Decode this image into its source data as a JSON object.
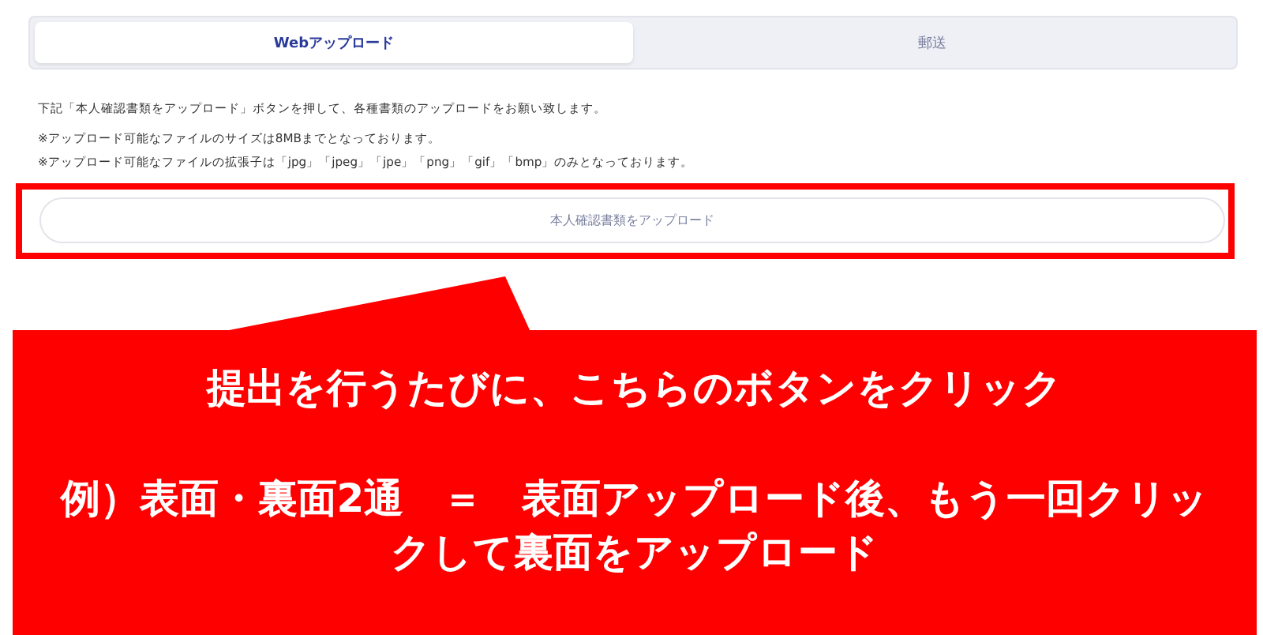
{
  "tabs": [
    {
      "label": "Webアップロード",
      "selected": true
    },
    {
      "label": "郵送",
      "selected": false
    }
  ],
  "instructions": [
    "下記「本人確認書類をアップロード」ボタンを押して、各種書類のアップロードをお願い致します。",
    "※アップロード可能なファイルのサイズは8MBまでとなっております。",
    "※アップロード可能なファイルの拡張子は「jpg」「jpeg」「jpe」「png」「gif」「bmp」のみとなっております。"
  ],
  "upload_button": {
    "label": "本人確認書類をアップロード"
  },
  "callout": {
    "lines": [
      "提出を行うたびに、こちらのボタンをクリック",
      "例）表面・裏面2通　＝　表面アップロード後、もう一回クリックして裏面をアップロード"
    ]
  }
}
